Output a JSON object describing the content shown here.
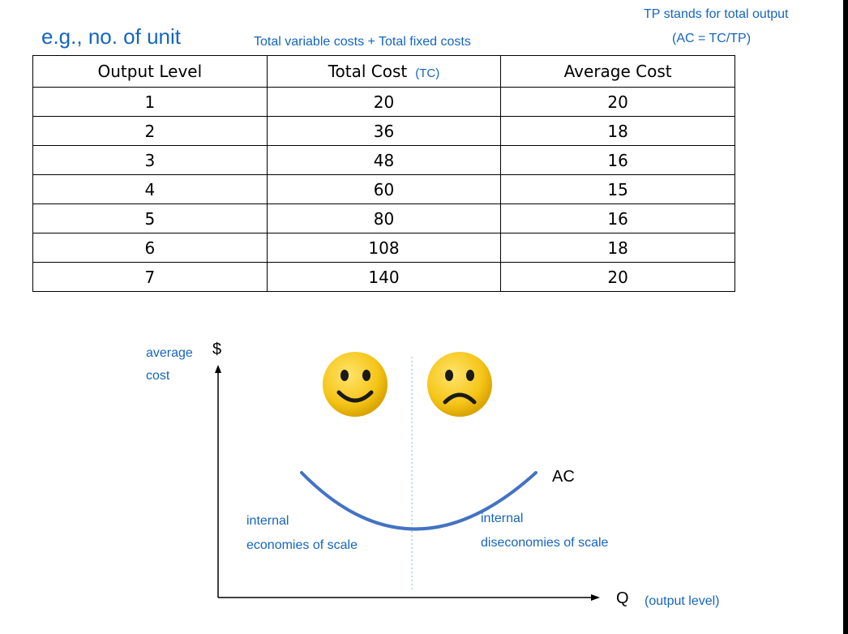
{
  "notes": {
    "tp_definition": "TP stands for total output",
    "ac_formula": "(AC = TC/TP)",
    "example_label": "e.g., no. of unit",
    "tc_definition": "Total variable costs + Total fixed costs"
  },
  "table": {
    "headers": [
      "Output Level",
      "Total Cost",
      "Average Cost"
    ],
    "tc_sub": "(TC)",
    "rows": [
      [
        "1",
        "20",
        "20"
      ],
      [
        "2",
        "36",
        "18"
      ],
      [
        "3",
        "48",
        "16"
      ],
      [
        "4",
        "60",
        "15"
      ],
      [
        "5",
        "80",
        "16"
      ],
      [
        "6",
        "108",
        "18"
      ],
      [
        "7",
        "140",
        "20"
      ]
    ]
  },
  "graph": {
    "y_axis_label": "$",
    "y_axis_desc_line1": "average",
    "y_axis_desc_line2": "cost",
    "x_axis_label": "Q",
    "x_axis_desc": "(output level)",
    "curve_label": "AC",
    "left_region_line1": "internal",
    "left_region_line2": "economies of scale",
    "right_region_line1": "internal",
    "right_region_line2": "diseconomies of scale",
    "left_face": "happy-face-icon",
    "right_face": "sad-face-icon",
    "colors": {
      "accent": "#1565c0",
      "curve": "#4472c4",
      "face": "#f5c518"
    }
  }
}
